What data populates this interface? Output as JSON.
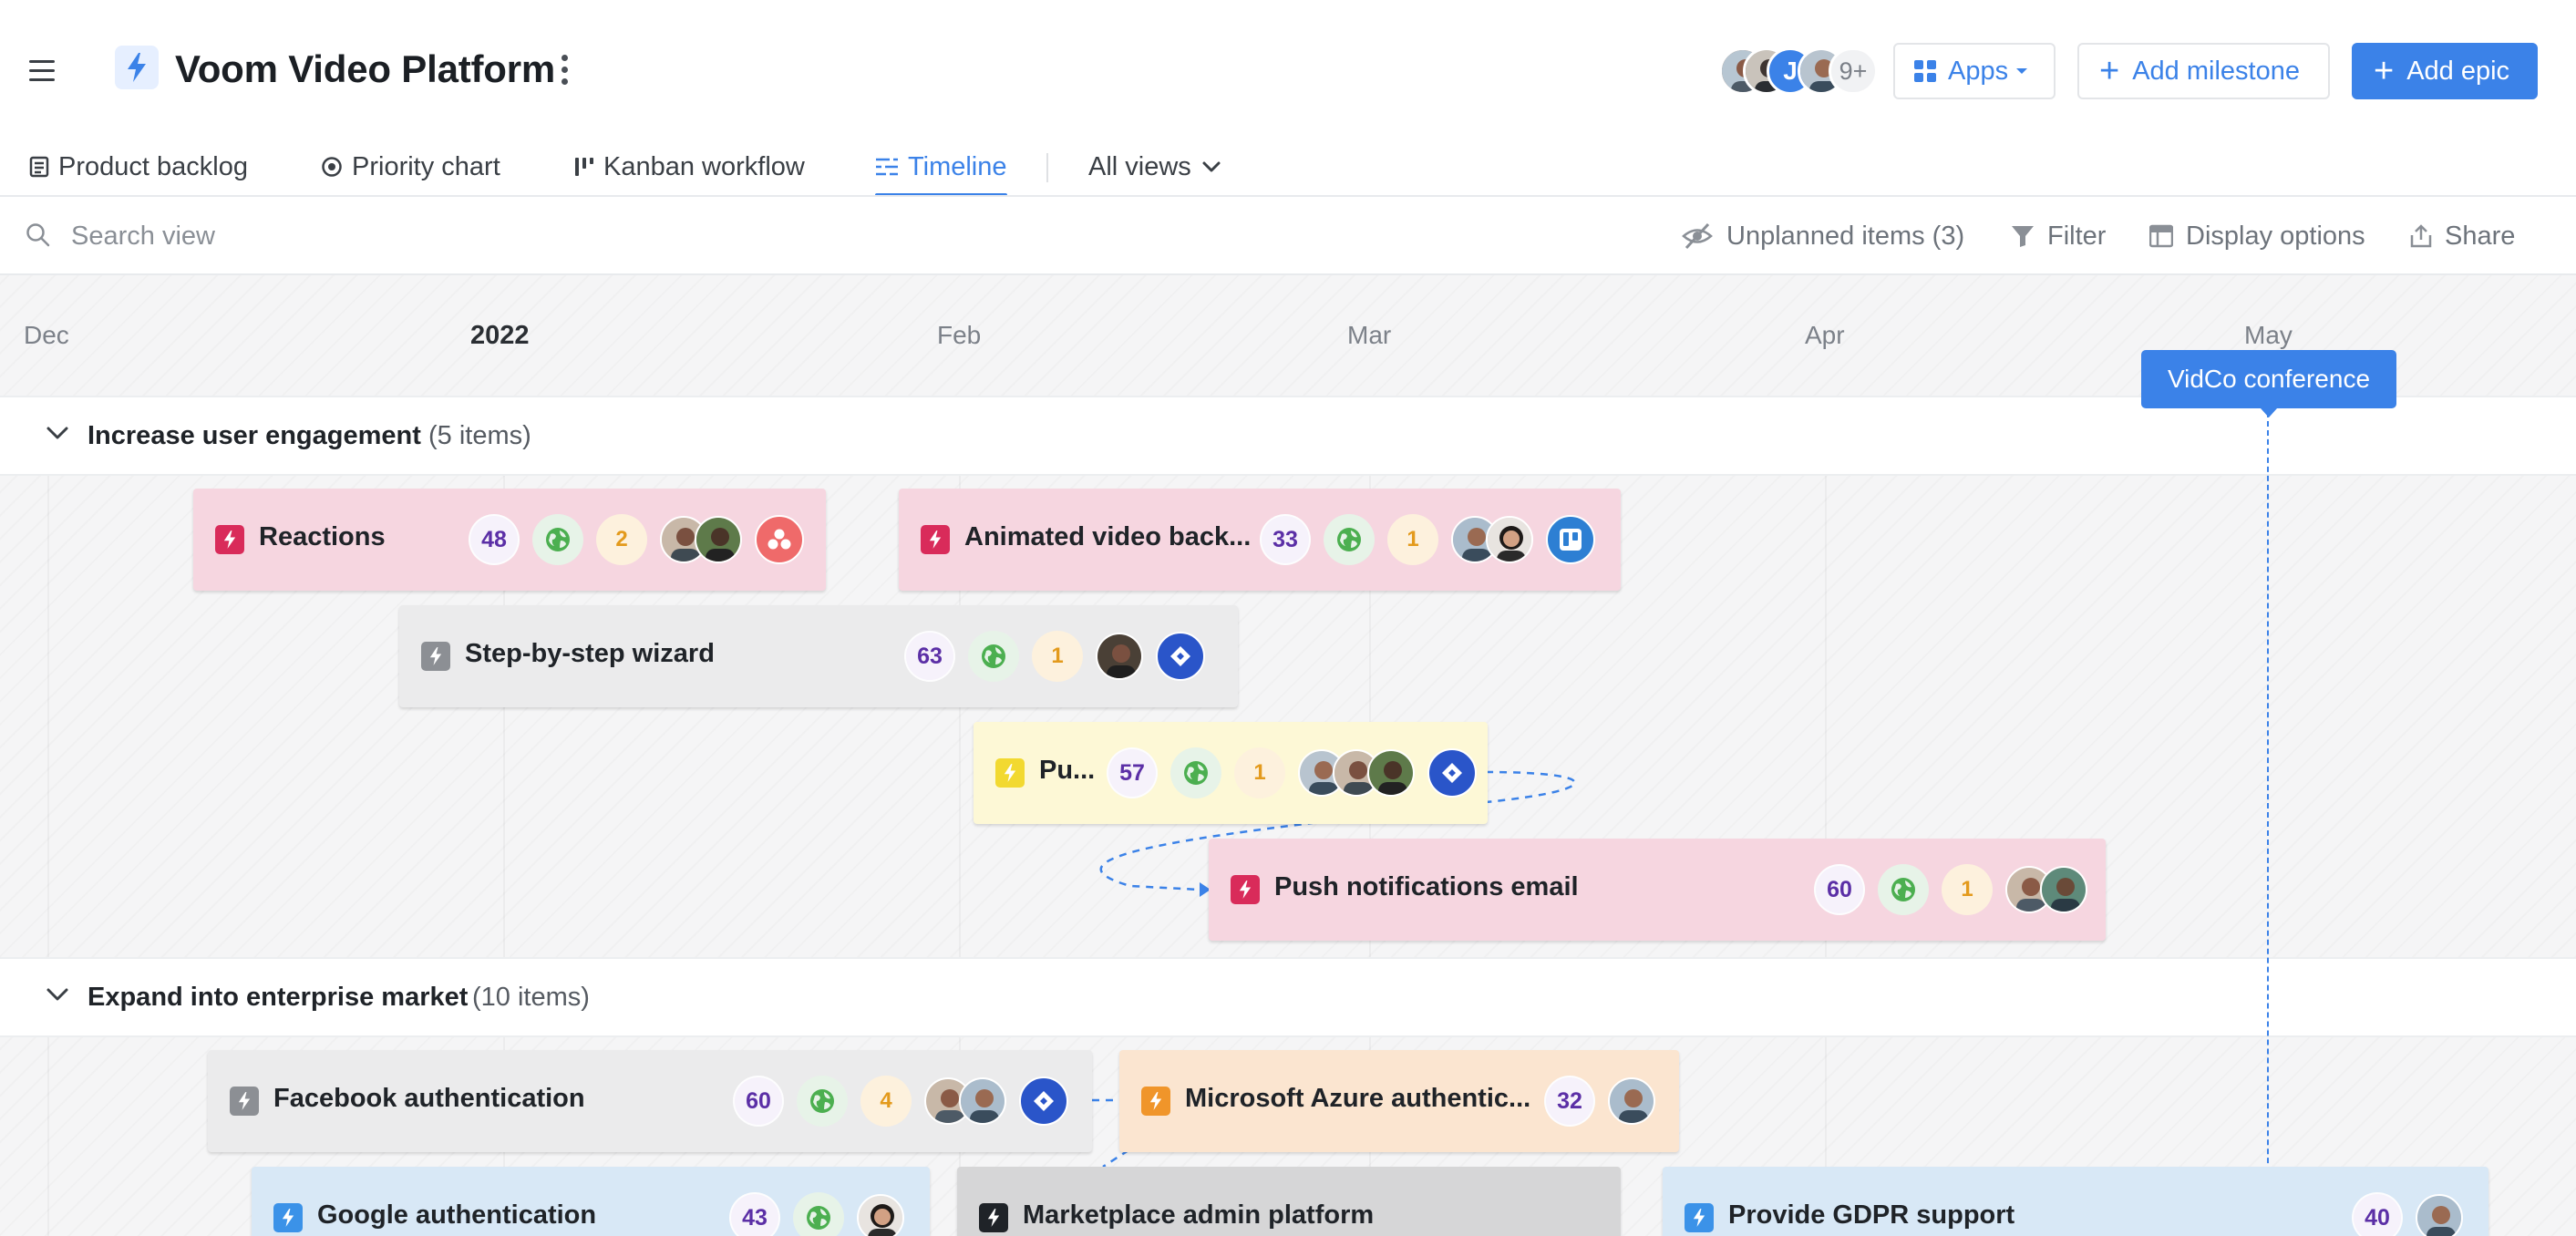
{
  "header": {
    "title": "Voom Video Platform",
    "avatars_more": "9+",
    "apps_label": "Apps",
    "add_milestone_label": "Add milestone",
    "add_epic_label": "Add epic"
  },
  "tabs": [
    {
      "label": "Product backlog",
      "icon": "list-icon"
    },
    {
      "label": "Priority chart",
      "icon": "target-icon"
    },
    {
      "label": "Kanban workflow",
      "icon": "kanban-icon"
    },
    {
      "label": "Timeline",
      "icon": "timeline-icon",
      "active": true
    },
    {
      "label": "All views",
      "icon": "chevron-down-icon"
    }
  ],
  "toolbar": {
    "search_placeholder": "Search view",
    "unplanned_label": "Unplanned items (3)",
    "filter_label": "Filter",
    "display_label": "Display options",
    "share_label": "Share"
  },
  "timeline": {
    "months": [
      "Dec",
      "2022",
      "Feb",
      "Mar",
      "Apr",
      "May"
    ],
    "milestone": "VidCo conference",
    "groups": [
      {
        "title": "Increase user engagement",
        "count": "(5 items)",
        "epics": [
          {
            "title": "Reactions",
            "points": "48",
            "count": "2",
            "color": "pink",
            "integration": "asana"
          },
          {
            "title": "Animated video back...",
            "points": "33",
            "count": "1",
            "color": "pink",
            "integration": "trello"
          },
          {
            "title": "Step-by-step wizard",
            "points": "63",
            "count": "1",
            "color": "gray",
            "integration": "jira"
          },
          {
            "title": "Pu...",
            "points": "57",
            "count": "1",
            "color": "yellow",
            "integration": "jira"
          },
          {
            "title": "Push notifications email",
            "points": "60",
            "count": "1",
            "color": "pink"
          }
        ]
      },
      {
        "title": "Expand into enterprise market",
        "count": "(10 items)",
        "epics": [
          {
            "title": "Facebook authentication",
            "points": "60",
            "count": "4",
            "color": "gray",
            "integration": "jira"
          },
          {
            "title": "Microsoft Azure authentic...",
            "points": "32",
            "color": "orange"
          },
          {
            "title": "Google authentication",
            "points": "43",
            "color": "blue"
          },
          {
            "title": "Marketplace admin platform",
            "color": "darkgray"
          },
          {
            "title": "Provide GDPR support",
            "points": "40",
            "color": "blue"
          }
        ]
      }
    ]
  },
  "colors": {
    "accent": "#3b82e8",
    "pink_icon": "#d92b5a",
    "gray_icon": "#8c8f94",
    "yellow_icon": "#f2d930",
    "orange_icon": "#f0952a",
    "blue_icon": "#3b92e8"
  }
}
